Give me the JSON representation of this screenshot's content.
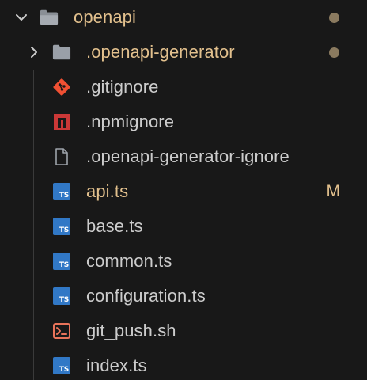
{
  "colors": {
    "background": "#181818",
    "modified_text": "#e2c08d",
    "default_text": "#cccccc",
    "dot": "#8a7a5f",
    "guide": "#3a3a3a",
    "ts_blue": "#3178c6",
    "git_orange": "#f05033",
    "npm_red": "#cb3837",
    "shell_orange": "#e8735a"
  },
  "tree": {
    "root": {
      "label": "openapi",
      "expanded": true,
      "icon": "folder-open-icon",
      "has_changes_dot": true
    },
    "items": [
      {
        "label": ".openapi-generator",
        "icon": "folder-icon",
        "kind": "folder",
        "expanded": false,
        "status": "dot"
      },
      {
        "label": ".gitignore",
        "icon": "git-icon",
        "kind": "file"
      },
      {
        "label": ".npmignore",
        "icon": "npm-icon",
        "kind": "file"
      },
      {
        "label": ".openapi-generator-ignore",
        "icon": "file-icon",
        "kind": "file"
      },
      {
        "label": "api.ts",
        "icon": "typescript-icon",
        "kind": "file",
        "status": "M"
      },
      {
        "label": "base.ts",
        "icon": "typescript-icon",
        "kind": "file"
      },
      {
        "label": "common.ts",
        "icon": "typescript-icon",
        "kind": "file"
      },
      {
        "label": "configuration.ts",
        "icon": "typescript-icon",
        "kind": "file"
      },
      {
        "label": "git_push.sh",
        "icon": "shell-icon",
        "kind": "file"
      },
      {
        "label": "index.ts",
        "icon": "typescript-icon",
        "kind": "file"
      }
    ]
  },
  "ts_icon_text": "TS"
}
